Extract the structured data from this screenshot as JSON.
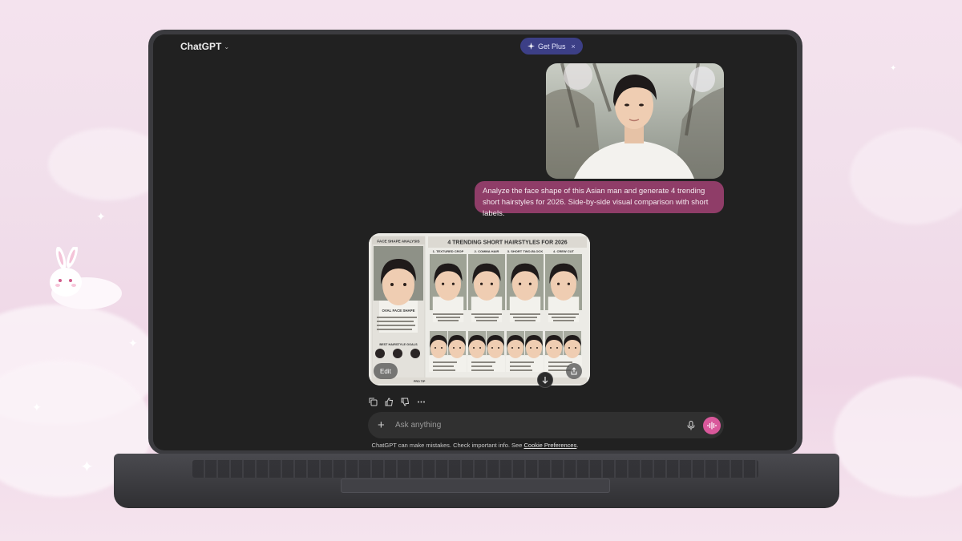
{
  "app": {
    "title": "ChatGPT",
    "title_caret": "⌄"
  },
  "upgrade": {
    "label": "Get Plus",
    "icon": "sparkle-icon",
    "close": "×"
  },
  "conversation": {
    "user_message": "Analyze the face shape of this Asian man and generate 4 trending short hairstyles for 2026. Side-by-side visual comparison with short labels.",
    "generated_image": {
      "left_title": "FACE SHAPE ANALYSIS",
      "main_title": "4 TRENDING SHORT HAIRSTYLES FOR 2026",
      "styles": [
        "1. TEXTURED CROP",
        "2. COMMA HAIR",
        "3. SHORT TWO-BLOCK",
        "4. CREW CUT"
      ],
      "left_sub1": "OVAL FACE SHAPE",
      "left_sub2": "BEST HAIRSTYLE GOALS",
      "pro_tip": "PRO TIP",
      "edit_label": "Edit"
    }
  },
  "message_actions": [
    "copy-icon",
    "thumbs-up-icon",
    "thumbs-down-icon",
    "more-icon"
  ],
  "composer": {
    "placeholder": "Ask anything",
    "plus": "+"
  },
  "footer": {
    "disclaimer": "ChatGPT can make mistakes. Check important info. See",
    "link": "Cookie Preferences",
    "end": "."
  },
  "colors": {
    "screen_bg": "#212121",
    "user_bubble": "#8f3d68",
    "get_plus_bg": "#3c3f86",
    "voice_button": "#d9589b",
    "background_pink": "#f1dfeb"
  }
}
